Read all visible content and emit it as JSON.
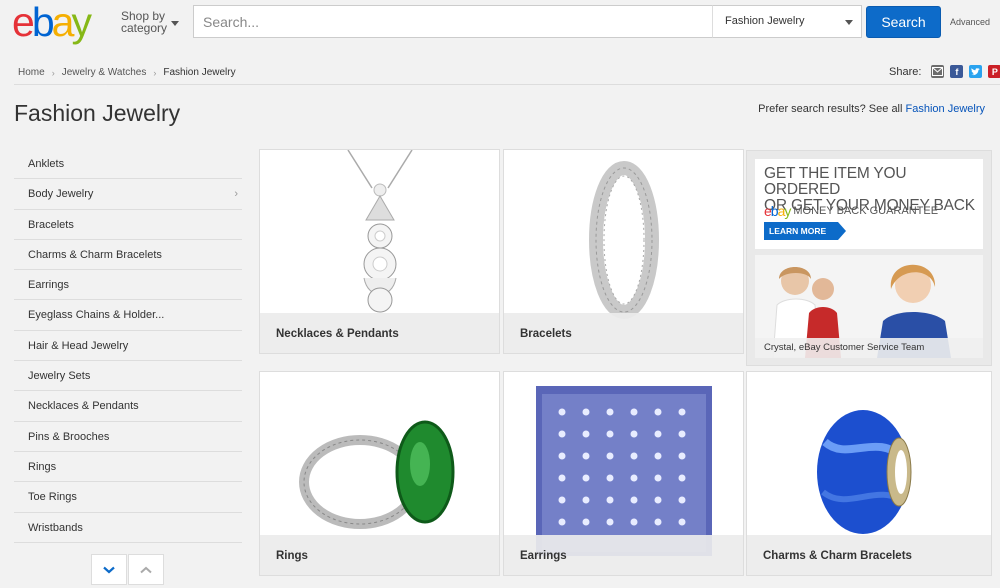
{
  "header": {
    "logo_letters": [
      {
        "char": "e",
        "color": "#e53238"
      },
      {
        "char": "b",
        "color": "#0064d2"
      },
      {
        "char": "a",
        "color": "#f5af02"
      },
      {
        "char": "y",
        "color": "#86b817"
      }
    ],
    "shop_by_line1": "Shop by",
    "shop_by_line2": "category",
    "search_placeholder": "Search...",
    "category_selected": "Fashion Jewelry",
    "search_button": "Search",
    "advanced": "Advanced"
  },
  "breadcrumb": [
    "Home",
    "Jewelry & Watches",
    "Fashion Jewelry"
  ],
  "share": {
    "label": "Share:",
    "icons": [
      "email-icon",
      "facebook-icon",
      "twitter-icon",
      "pinterest-icon"
    ]
  },
  "page": {
    "title": "Fashion Jewelry",
    "prefer_text": "Prefer search results? See all ",
    "prefer_link": "Fashion Jewelry"
  },
  "sidebar": {
    "items": [
      {
        "label": "Anklets",
        "has_children": false
      },
      {
        "label": "Body Jewelry",
        "has_children": true
      },
      {
        "label": "Bracelets",
        "has_children": false
      },
      {
        "label": "Charms & Charm Bracelets",
        "has_children": false
      },
      {
        "label": "Earrings",
        "has_children": false
      },
      {
        "label": "Eyeglass Chains & Holder...",
        "has_children": false
      },
      {
        "label": "Hair & Head Jewelry",
        "has_children": false
      },
      {
        "label": "Jewelry Sets",
        "has_children": false
      },
      {
        "label": "Necklaces & Pendants",
        "has_children": false
      },
      {
        "label": "Pins & Brooches",
        "has_children": false
      },
      {
        "label": "Rings",
        "has_children": false
      },
      {
        "label": "Toe Rings",
        "has_children": false
      },
      {
        "label": "Wristbands",
        "has_children": false
      }
    ]
  },
  "tiles": [
    {
      "label": "Necklaces & Pendants"
    },
    {
      "label": "Bracelets"
    },
    {
      "label": "Rings"
    },
    {
      "label": "Earrings"
    },
    {
      "label": "Charms & Charm Bracelets"
    }
  ],
  "ad": {
    "headline_line1": "GET THE ITEM YOU ORDERED",
    "headline_line2": "OR GET YOUR MONEY BACK",
    "mbg": "MONEY BACK GUARANTEE",
    "learn_more": "LEARN MORE",
    "caption": "Crystal, eBay Customer Service Team"
  },
  "colors": {
    "accent": "#0d6bc9",
    "link": "#0654ba",
    "facebook": "#3b5998",
    "twitter": "#2aa3ef",
    "pinterest": "#cb2027",
    "email": "#6d6d6d"
  }
}
